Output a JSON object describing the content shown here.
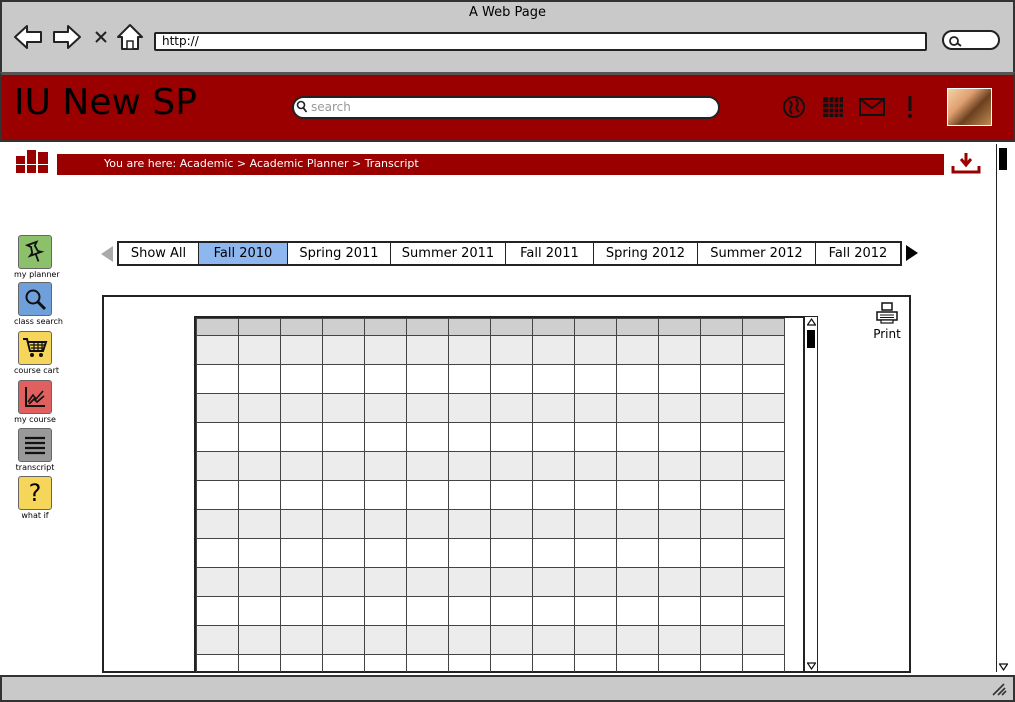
{
  "browser": {
    "title": "A Web Page",
    "url": "http://"
  },
  "header": {
    "app_title": "IU New SP",
    "search_placeholder": "search",
    "brand_color": "#9b0000",
    "icons": [
      "globe-icon",
      "calendar-icon",
      "mail-icon",
      "alert-icon"
    ]
  },
  "breadcrumb": {
    "text": "You are here: Academic > Academic Planner > Transcript"
  },
  "sidebar": {
    "items": [
      {
        "label": "my planner",
        "icon": "pin-icon",
        "color": "#8cc06a"
      },
      {
        "label": "class search",
        "icon": "magnifier-icon",
        "color": "#6fa0dc"
      },
      {
        "label": "course cart",
        "icon": "cart-icon",
        "color": "#f5d55a"
      },
      {
        "label": "my course",
        "icon": "chart-icon",
        "color": "#e06060"
      },
      {
        "label": "transcript",
        "icon": "list-icon",
        "color": "#999999"
      },
      {
        "label": "what if",
        "icon": "question-icon",
        "color": "#f5d55a"
      }
    ]
  },
  "terms": {
    "tabs": [
      "Show All",
      "Fall 2010",
      "Spring 2011",
      "Summer 2011",
      "Fall 2011",
      "Spring 2012",
      "Summer 2012",
      "Fall 2012"
    ],
    "active": "Fall 2010",
    "active_color": "#8eb7ef"
  },
  "panel": {
    "print_label": "Print"
  }
}
